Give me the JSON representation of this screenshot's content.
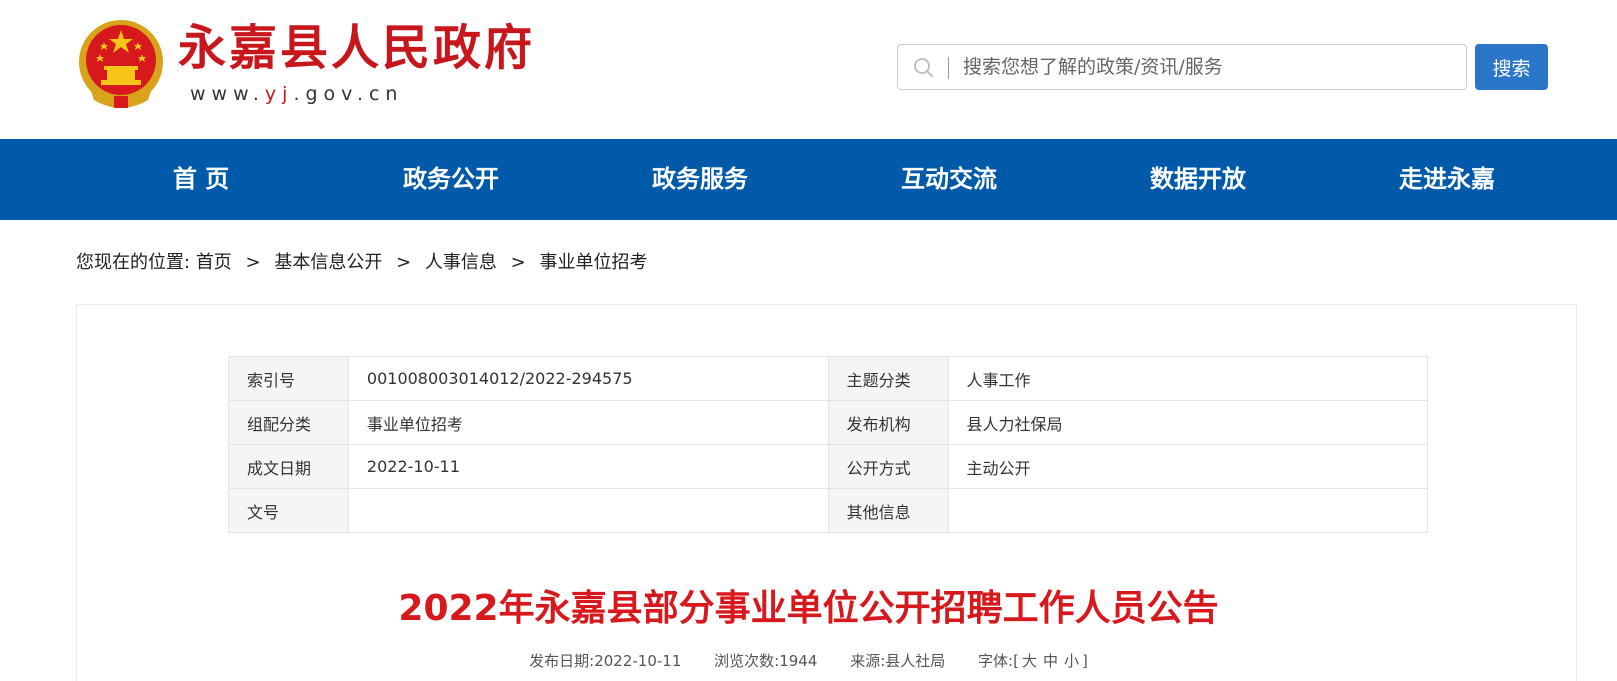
{
  "header": {
    "site_title": "永嘉县人民政府",
    "site_url_prefix": "www.",
    "site_url_highlight": "yj",
    "site_url_suffix": ".gov.cn",
    "search_placeholder": "搜索您想了解的政策/资讯/服务",
    "search_button": "搜索",
    "brand_red": "#c8161d",
    "search_button_color": "#2c76c9"
  },
  "nav": {
    "background": "#0059a9",
    "items": [
      {
        "label": "首 页"
      },
      {
        "label": "政务公开"
      },
      {
        "label": "政务服务"
      },
      {
        "label": "互动交流"
      },
      {
        "label": "数据开放"
      },
      {
        "label": "走进永嘉"
      }
    ]
  },
  "breadcrumb": {
    "prefix": "您现在的位置:",
    "items": [
      "首页",
      "基本信息公开",
      "人事信息",
      "事业单位招考"
    ],
    "separator": ">"
  },
  "meta_table": {
    "rows": [
      {
        "label1": "索引号",
        "value1": "001008003014012/2022-294575",
        "label2": "主题分类",
        "value2": "人事工作"
      },
      {
        "label1": "组配分类",
        "value1": "事业单位招考",
        "label2": "发布机构",
        "value2": "县人力社保局"
      },
      {
        "label1": "成文日期",
        "value1": "2022-10-11",
        "label2": "公开方式",
        "value2": "主动公开"
      },
      {
        "label1": "文号",
        "value1": "",
        "label2": "其他信息",
        "value2": ""
      }
    ]
  },
  "article": {
    "title": "2022年永嘉县部分事业单位公开招聘工作人员公告",
    "title_color": "#d7191d",
    "publish_date_label": "发布日期:",
    "publish_date": "2022-10-11",
    "views_label": "浏览次数:",
    "views": "1944",
    "source_label": "来源:",
    "source": "县人社局",
    "font_label": "字体:",
    "font_open": "[",
    "font_large": "大",
    "font_medium": "中",
    "font_small": "小",
    "font_close": "]"
  }
}
